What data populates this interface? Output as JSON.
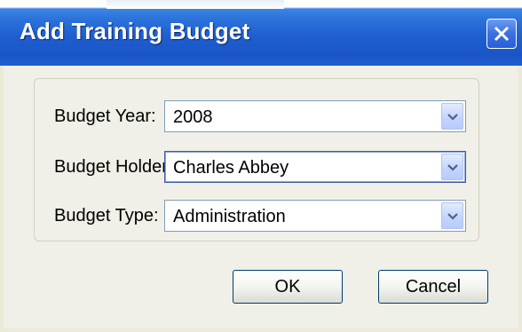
{
  "window": {
    "title": "Add Training Budget",
    "close_icon": "close-icon"
  },
  "form": {
    "budget_year": {
      "label": "Budget Year:",
      "value": "2008"
    },
    "budget_holder": {
      "label": "Budget Holder:",
      "value": "Charles Abbey"
    },
    "budget_type": {
      "label": "Budget Type:",
      "value": "Administration"
    }
  },
  "buttons": {
    "ok": "OK",
    "cancel": "Cancel"
  },
  "colors": {
    "titlebar": "#1f5fd0",
    "dialog_bg": "#f0f0e8",
    "button_border": "#003c74"
  }
}
